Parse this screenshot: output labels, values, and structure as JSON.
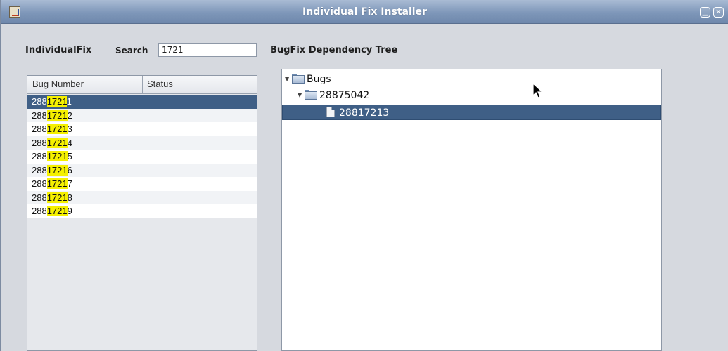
{
  "window": {
    "title": "Individual Fix Installer"
  },
  "toolbar": {
    "label": "IndividualFix",
    "search_label": "Search",
    "search_value": "1721"
  },
  "tree_title": "BugFix Dependency Tree",
  "table": {
    "columns": [
      "Bug Number",
      "Status"
    ],
    "rows": [
      {
        "pre": "288",
        "match": "1721",
        "post": "1",
        "status": "",
        "selected": true
      },
      {
        "pre": "288",
        "match": "1721",
        "post": "2",
        "status": ""
      },
      {
        "pre": "288",
        "match": "1721",
        "post": "3",
        "status": ""
      },
      {
        "pre": "288",
        "match": "1721",
        "post": "4",
        "status": ""
      },
      {
        "pre": "288",
        "match": "1721",
        "post": "5",
        "status": ""
      },
      {
        "pre": "288",
        "match": "1721",
        "post": "6",
        "status": ""
      },
      {
        "pre": "288",
        "match": "1721",
        "post": "7",
        "status": ""
      },
      {
        "pre": "288",
        "match": "1721",
        "post": "8",
        "status": ""
      },
      {
        "pre": "288",
        "match": "1721",
        "post": "9",
        "status": ""
      }
    ]
  },
  "tree": {
    "root": "Bugs",
    "parent": "28875042",
    "child": "28817213"
  },
  "colors": {
    "selection": "#3f5f86",
    "highlight": "#f5f000",
    "titlebar": "#7e97b9"
  }
}
